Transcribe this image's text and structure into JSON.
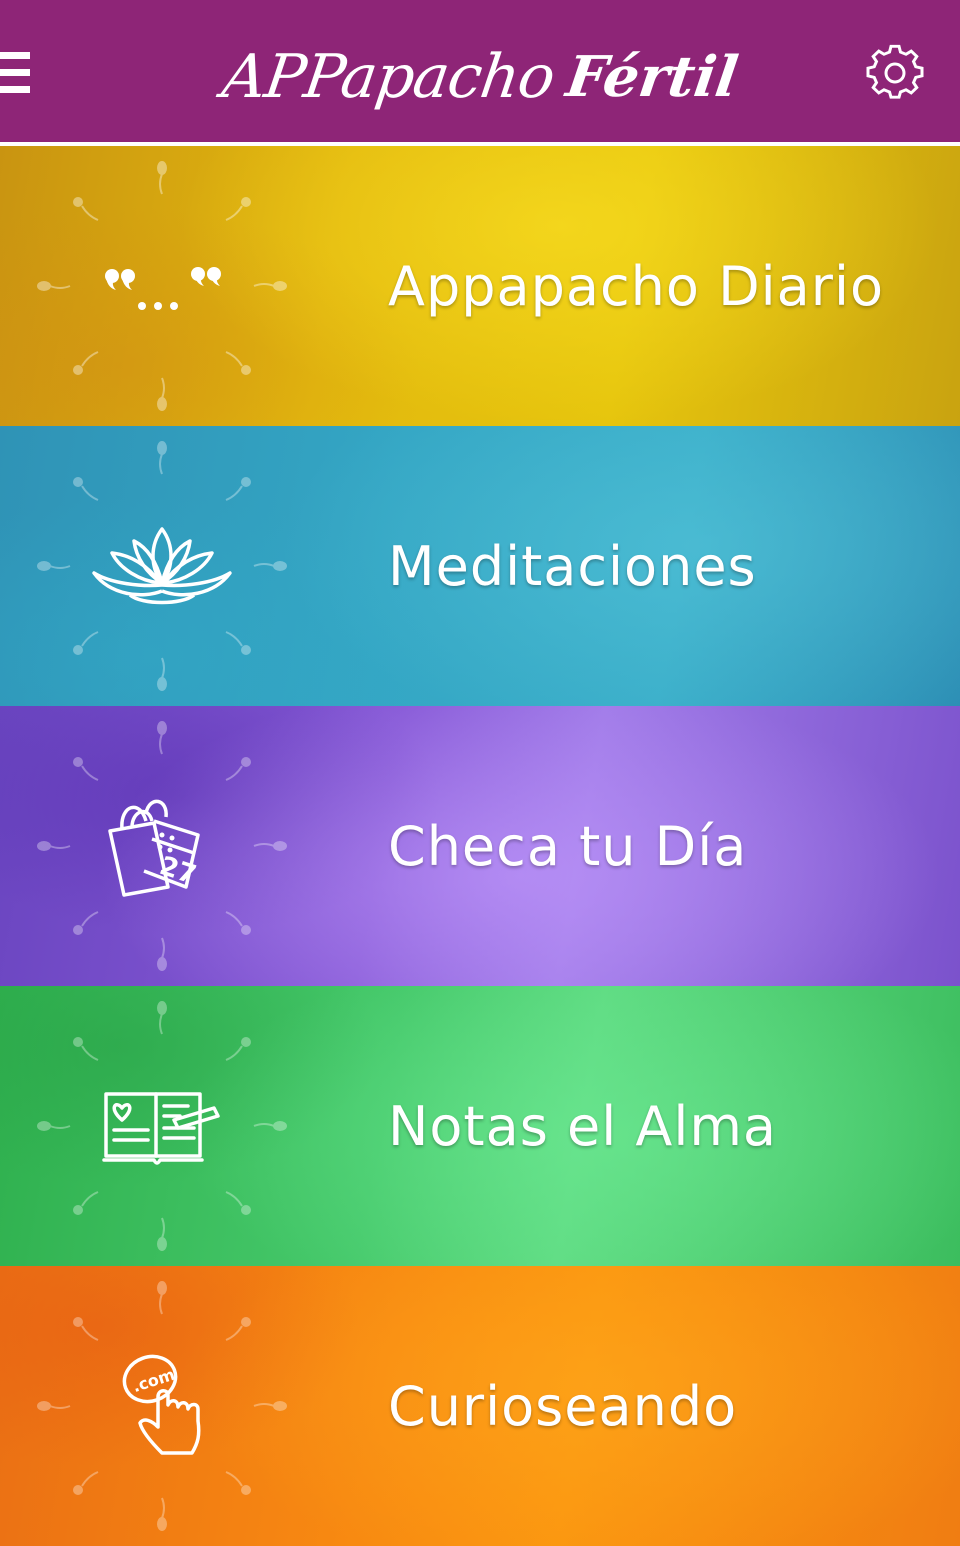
{
  "header": {
    "title_script": "APPapacho",
    "title_bold": "Fértil",
    "background_color": "#8e2577",
    "menu_icon": "hamburger-menu-icon",
    "settings_icon": "gear-icon"
  },
  "menu": {
    "items": [
      {
        "label": "Appapacho Diario",
        "icon": "quote-ellipsis-icon",
        "color": "#e2b80e"
      },
      {
        "label": "Meditaciones",
        "icon": "lotus-icon",
        "color": "#34a6c4"
      },
      {
        "label": "Checa tu Día",
        "icon": "calendar-bag-icon",
        "calendar_day": "27",
        "color": "#8659d6"
      },
      {
        "label": "Notas el Alma",
        "icon": "journal-pen-icon",
        "color": "#46c96b"
      },
      {
        "label": "Curioseando",
        "icon": "web-click-hand-icon",
        "badge_text": ".com",
        "color": "#f88a11"
      }
    ]
  }
}
